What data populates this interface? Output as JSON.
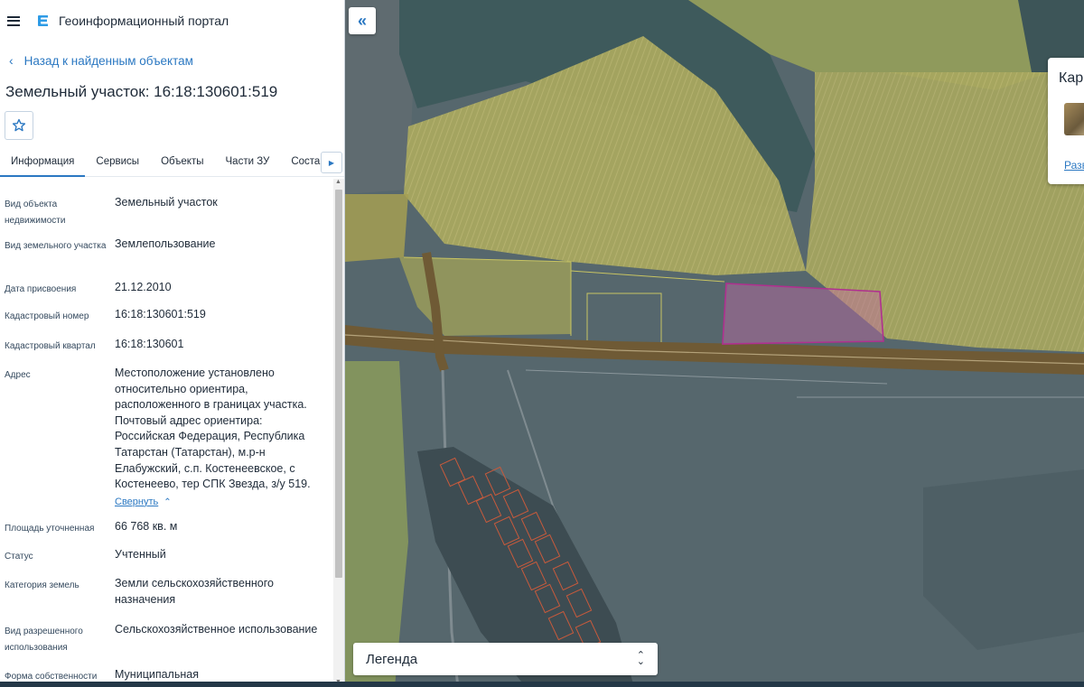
{
  "header": {
    "app_title": "Геоинформационный портал"
  },
  "nav": {
    "back_label": "Назад к найденным объектам"
  },
  "object": {
    "title": "Земельный участок: 16:18:130601:519"
  },
  "tabs": [
    {
      "label": "Информация"
    },
    {
      "label": "Сервисы"
    },
    {
      "label": "Объекты"
    },
    {
      "label": "Части ЗУ"
    },
    {
      "label": "Состав"
    }
  ],
  "info": {
    "kind_label": "Вид объекта недвижимости",
    "kind_value": "Земельный участок",
    "type_label": "Вид земельного участка",
    "type_value": "Землепользование",
    "date_label": "Дата присвоения",
    "date_value": "21.12.2010",
    "cad_label": "Кадастровый номер",
    "cad_value": "16:18:130601:519",
    "block_label": "Кадастровый квартал",
    "block_value": "16:18:130601",
    "address_label": "Адрес",
    "address_value": "Местоположение установлено относительно ориентира, расположенного в границах участка. Почтовый адрес ориентира: Российская Федерация, Республика Татарстан (Татарстан), м.р-н Елабужский, с.п. Костенеевское, с Костенеево, тер СПК Звезда, з/у 519.",
    "collapse_label": "Свернуть",
    "area_label": "Площадь уточненная",
    "area_value": "66 768 кв. м",
    "status_label": "Статус",
    "status_value": "Учтенный",
    "category_label": "Категория земель",
    "category_value": "Земли сельскохозяйственного назначения",
    "use_label": "Вид разрешенного использования",
    "use_value": "Сельскохозяйственное использование",
    "ownership_label": "Форма собственности",
    "ownership_value": "Муниципальная"
  },
  "map": {
    "legend_label": "Легенда",
    "basemap_title": "Кар",
    "basemap_link": "Разв",
    "highlight_color": "#b0308f"
  }
}
